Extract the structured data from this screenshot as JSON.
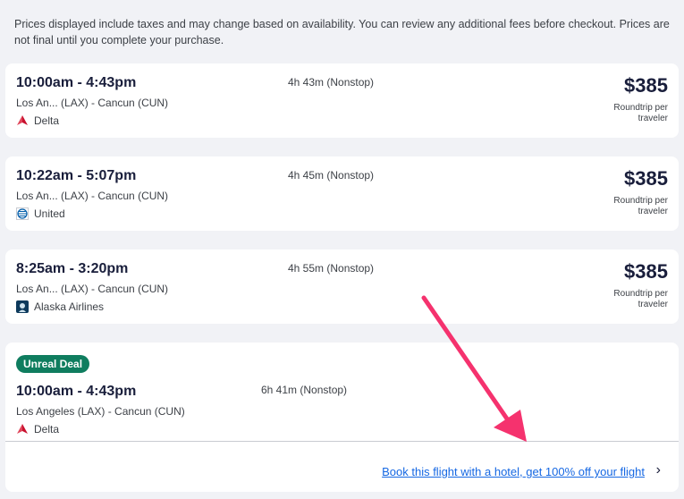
{
  "notice": "Prices displayed include taxes and may change based on availability. You can review any additional fees before checkout. Prices are not final until you complete your purchase.",
  "flights": [
    {
      "time": "10:00am - 4:43pm",
      "route": "Los An... (LAX) - Cancun (CUN)",
      "airline": "Delta",
      "logo_icon": "delta-logo-icon",
      "duration": "4h 43m (Nonstop)",
      "price": "$385",
      "price_sub": "Roundtrip per traveler"
    },
    {
      "time": "10:22am - 5:07pm",
      "route": "Los An... (LAX) - Cancun (CUN)",
      "airline": "United",
      "logo_icon": "united-logo-icon",
      "duration": "4h 45m (Nonstop)",
      "price": "$385",
      "price_sub": "Roundtrip per traveler"
    },
    {
      "time": "8:25am - 3:20pm",
      "route": "Los An... (LAX) - Cancun (CUN)",
      "airline": "Alaska Airlines",
      "logo_icon": "alaska-logo-icon",
      "duration": "4h 55m (Nonstop)",
      "price": "$385",
      "price_sub": "Roundtrip per traveler"
    }
  ],
  "deal": {
    "badge": "Unreal Deal",
    "time": "10:00am - 4:43pm",
    "route": "Los Angeles (LAX) - Cancun (CUN)",
    "airline": "Delta",
    "logo_icon": "delta-logo-icon",
    "duration": "6h 41m (Nonstop)",
    "hotel_link": "Book this flight with a hotel, get 100% off your flight",
    "chevron_icon": "chevron-right-icon"
  },
  "colors": {
    "badge": "#0f7d5f",
    "link": "#1668e3",
    "annotation_arrow": "#f5326e"
  }
}
